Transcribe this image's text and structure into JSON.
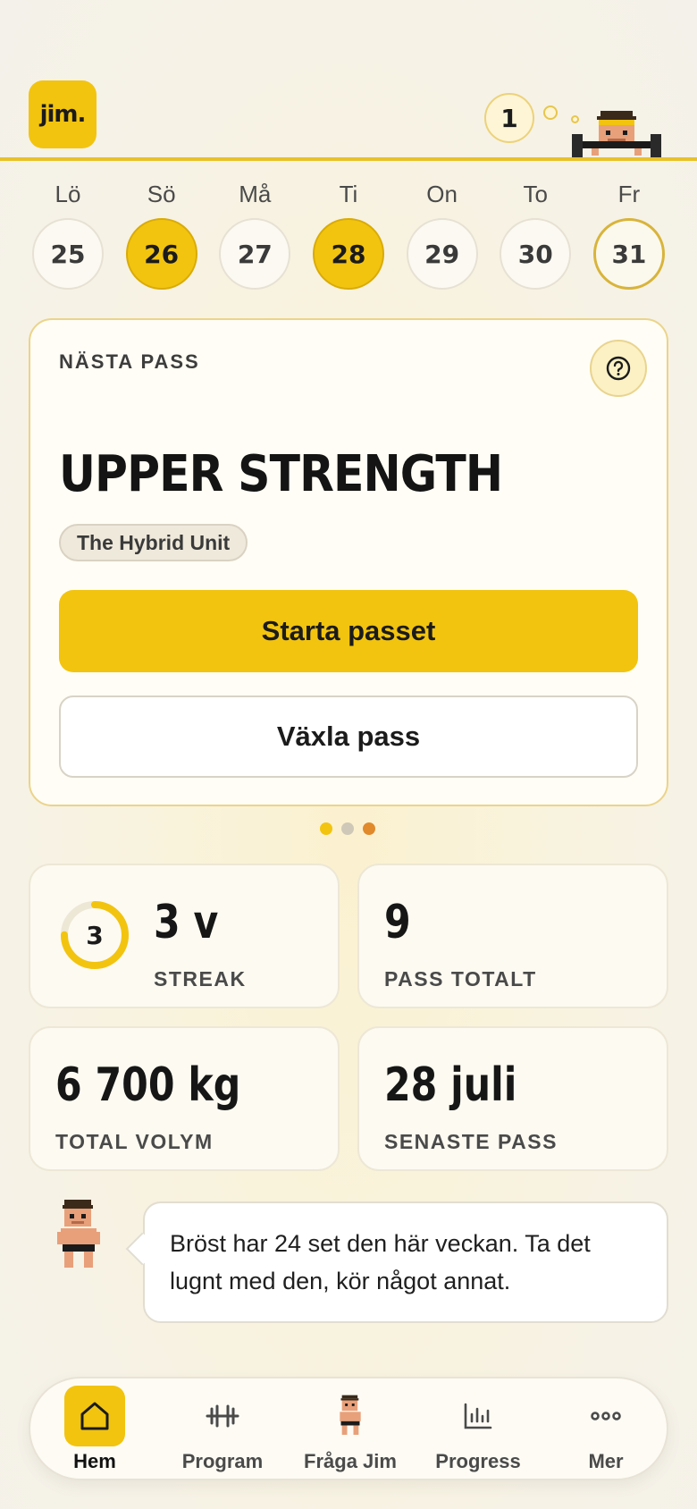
{
  "header": {
    "logo_text": "jim.",
    "notification_count": "1"
  },
  "week": [
    {
      "name": "Lö",
      "date": "25",
      "state": "none"
    },
    {
      "name": "Sö",
      "date": "26",
      "state": "done"
    },
    {
      "name": "Må",
      "date": "27",
      "state": "none"
    },
    {
      "name": "Ti",
      "date": "28",
      "state": "done"
    },
    {
      "name": "On",
      "date": "29",
      "state": "none"
    },
    {
      "name": "To",
      "date": "30",
      "state": "none"
    },
    {
      "name": "Fr",
      "date": "31",
      "state": "today"
    }
  ],
  "next_session": {
    "label": "NÄSTA PASS",
    "help_icon": "question-circle-icon",
    "title": "UPPER STRENGTH",
    "program": "The Hybrid Unit",
    "start_label": "Starta passet",
    "switch_label": "Växla pass"
  },
  "carousel": {
    "active_index": 0,
    "dot_colors": [
      "#f2c40f",
      "#cfc8b8",
      "#e08a2c"
    ]
  },
  "stats": {
    "streak": {
      "ring_value": "3",
      "value": "3 v",
      "label": "STREAK",
      "progress": 0.75
    },
    "total_sessions": {
      "value": "9",
      "label": "PASS TOTALT"
    },
    "total_volume": {
      "value": "6 700 kg",
      "label": "TOTAL VOLYM"
    },
    "last_session": {
      "value": "28 juli",
      "label": "SENASTE PASS"
    }
  },
  "jim_message": "Bröst har 24 set den här veckan. Ta det lugnt med den, kör något annat.",
  "nav": [
    {
      "label": "Hem",
      "icon": "home-icon",
      "active": true
    },
    {
      "label": "Program",
      "icon": "dumbbell-icon",
      "active": false
    },
    {
      "label": "Fråga Jim",
      "icon": "jim-avatar-icon",
      "active": false
    },
    {
      "label": "Progress",
      "icon": "bar-chart-icon",
      "active": false
    },
    {
      "label": "Mer",
      "icon": "more-dots-icon",
      "active": false
    }
  ],
  "colors": {
    "accent": "#f2c40f",
    "accent_border": "#d9ab06",
    "card_border": "#ebd48a"
  }
}
